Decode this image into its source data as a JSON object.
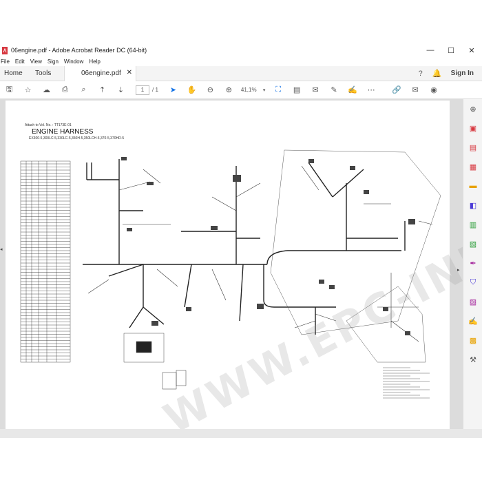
{
  "window": {
    "title": "06engine.pdf - Adobe Acrobat Reader DC (64-bit)"
  },
  "menu": [
    "File",
    "Edit",
    "View",
    "Sign",
    "Window",
    "Help"
  ],
  "tabs": {
    "home": "Home",
    "tools": "Tools",
    "document": "06engine.pdf"
  },
  "signin": "Sign In",
  "toolbar": {
    "page_current": "1",
    "page_total": "/ 1",
    "zoom": "41,1%"
  },
  "document": {
    "attach": "Attach to Vol. No. : TT173E-01",
    "title": "ENGINE HARNESS",
    "subtitle": "EX300-5,300LC-5,330LC-5,350H-5,350LCH-5,370-5,370HD-5",
    "watermark": "WWW.EPC-INFO.COM"
  },
  "colors": {
    "accent": "#1473e6",
    "acrobat_red": "#d7373f"
  }
}
